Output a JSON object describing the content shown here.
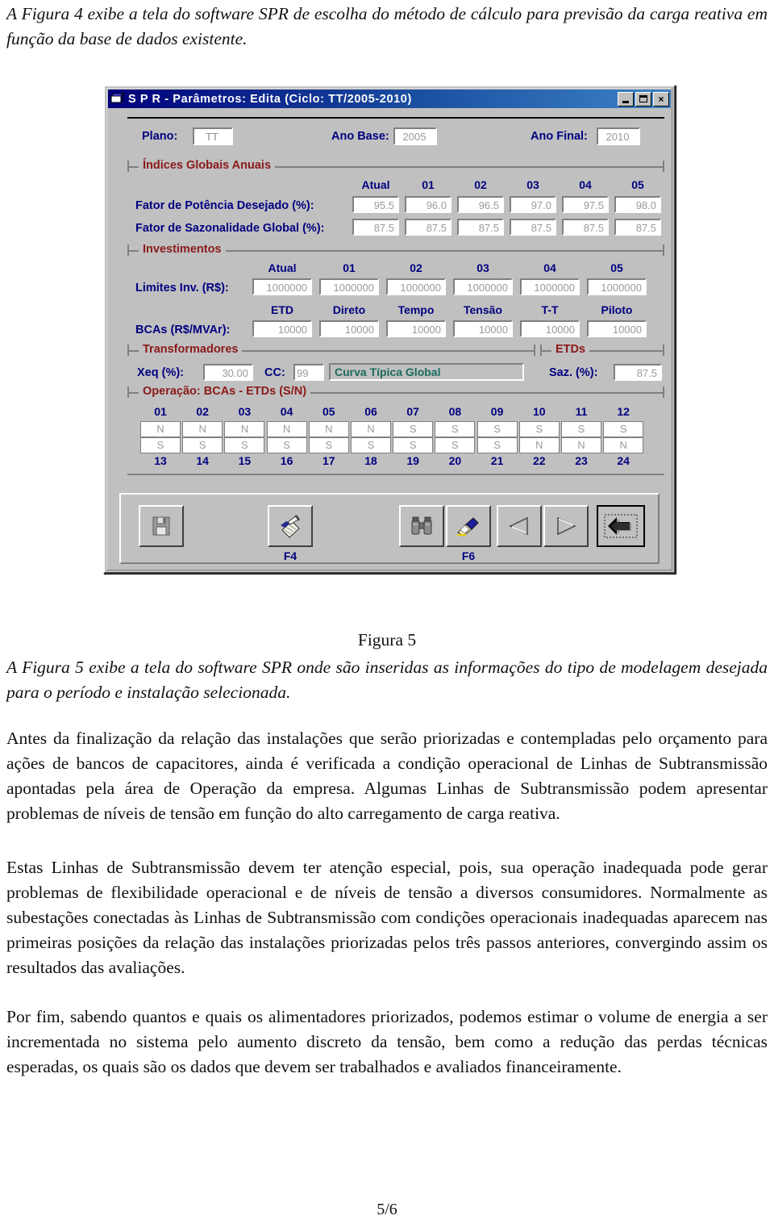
{
  "document": {
    "intro_paragraph": "A Figura 4 exibe a tela do software SPR de escolha do método de cálculo para previsão da carga reativa em função da base de dados existente.",
    "figure_caption": "Figura 5",
    "figure_description": "A Figura 5 exibe a tela do software SPR onde são inseridas as informações do tipo de modelagem desejada para o período e instalação selecionada.",
    "paragraph_1": "Antes da finalização da relação das instalações que serão priorizadas e contempladas pelo orçamento para ações de bancos de capacitores, ainda é verificada a condição operacional de Linhas de Subtransmissão apontadas pela área de Operação da empresa. Algumas Linhas de Subtransmissão podem apresentar problemas de níveis de tensão em função do alto carregamento de carga reativa.",
    "paragraph_2": "Estas Linhas de Subtransmissão devem ter atenção especial, pois, sua operação inadequada pode gerar problemas de flexibilidade operacional e de níveis de tensão a diversos consumidores. Normalmente as subestações conectadas às Linhas de Subtransmissão com condições operacionais inadequadas aparecem nas primeiras posições da relação das instalações priorizadas pelos três passos anteriores, convergindo assim os resultados das avaliações.",
    "paragraph_3": "Por fim, sabendo quantos e quais os alimentadores priorizados, podemos estimar o volume de energia a ser incrementada no sistema pelo aumento discreto da tensão, bem como a redução das perdas técnicas esperadas, os quais são os dados que devem ser trabalhados e avaliados financeiramente.",
    "page_number": "5/6"
  },
  "dialog": {
    "title": "S P R - Parâmetros: Edita (Ciclo: TT/2005-2010)",
    "window_buttons": {
      "minimize": "minimize-button",
      "maximize": "maximize-button",
      "close": "×"
    },
    "header": {
      "plano_label": "Plano:",
      "plano_value": "TT",
      "ano_base_label": "Ano Base:",
      "ano_base_value": "2005",
      "ano_final_label": "Ano Final:",
      "ano_final_value": "2010"
    },
    "indices_globais": {
      "caption": "Índices Globais Anuais",
      "columns": [
        "Atual",
        "01",
        "02",
        "03",
        "04",
        "05"
      ],
      "rows": [
        {
          "label": "Fator de Potência Desejado   (%):",
          "values": [
            "95.5",
            "96.0",
            "96.5",
            "97.0",
            "97.5",
            "98.0"
          ]
        },
        {
          "label": "Fator de Sazonalidade Global (%):",
          "values": [
            "87.5",
            "87.5",
            "87.5",
            "87.5",
            "87.5",
            "87.5"
          ]
        }
      ]
    },
    "investimentos": {
      "caption": "Investimentos",
      "columns_year": [
        "Atual",
        "01",
        "02",
        "03",
        "04",
        "05"
      ],
      "limites_label": "Limites Inv. (R$):",
      "limites_values": [
        "1000000",
        "1000000",
        "1000000",
        "1000000",
        "1000000",
        "1000000"
      ],
      "columns_bca": [
        "ETD",
        "Direto",
        "Tempo",
        "Tensão",
        "T-T",
        "Piloto"
      ],
      "bcas_label": "BCAs (R$/MVAr):",
      "bcas_values": [
        "10000",
        "10000",
        "10000",
        "10000",
        "10000",
        "10000"
      ]
    },
    "transformadores": {
      "caption": "Transformadores",
      "xeq_label": "Xeq  (%):",
      "xeq_value": "30.00",
      "cc_label": "CC:",
      "cc_value": "99",
      "curva_value": "Curva Típica Global"
    },
    "etds": {
      "caption": "ETDs",
      "saz_label": "Saz. (%):",
      "saz_value": "87.5"
    },
    "operacao": {
      "caption": "Operação: BCAs - ETDs (S/N)",
      "hours_top": [
        "01",
        "02",
        "03",
        "04",
        "05",
        "06",
        "07",
        "08",
        "09",
        "10",
        "11",
        "12"
      ],
      "values_top": [
        "N",
        "N",
        "N",
        "N",
        "N",
        "N",
        "S",
        "S",
        "S",
        "S",
        "S",
        "S"
      ],
      "values_bottom": [
        "S",
        "S",
        "S",
        "S",
        "S",
        "S",
        "S",
        "S",
        "S",
        "N",
        "N",
        "N"
      ],
      "hours_bottom": [
        "13",
        "14",
        "15",
        "16",
        "17",
        "18",
        "19",
        "20",
        "21",
        "22",
        "23",
        "24"
      ]
    },
    "toolbar": {
      "buttons": [
        {
          "name": "save-button",
          "icon": "floppy-disk-icon",
          "fkey": ""
        },
        {
          "name": "edit-button",
          "icon": "pencil-notepad-icon",
          "fkey": "F4"
        },
        {
          "name": "find-button",
          "icon": "binoculars-icon",
          "fkey": ""
        },
        {
          "name": "paint-button",
          "icon": "paintbrush-icon",
          "fkey": "F6"
        },
        {
          "name": "previous-button",
          "icon": "triangle-left-icon",
          "fkey": ""
        },
        {
          "name": "next-button",
          "icon": "triangle-right-icon",
          "fkey": ""
        },
        {
          "name": "exit-button",
          "icon": "back-arrow-icon",
          "fkey": ""
        }
      ]
    }
  },
  "colors": {
    "titlebar_start": "#00007b",
    "titlebar_end": "#3c82c8",
    "dialog_face": "#c0c0c0",
    "label_blue": "#000080",
    "group_red": "#8b1a1a",
    "field_text": "#9a9a9a",
    "curva_text": "#1b6b5f"
  }
}
